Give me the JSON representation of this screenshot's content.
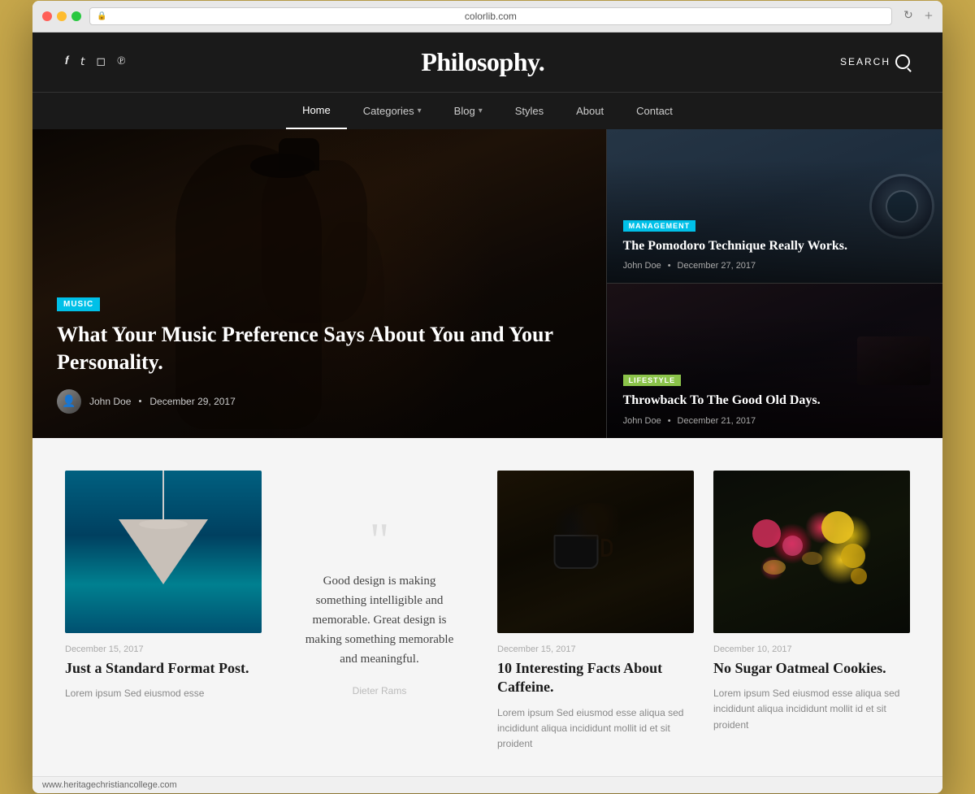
{
  "browser": {
    "url": "colorlib.com",
    "new_tab_label": "+"
  },
  "header": {
    "logo": "Philosophy.",
    "search_label": "SEARCH",
    "social_links": [
      {
        "icon": "facebook-icon",
        "symbol": "f"
      },
      {
        "icon": "twitter-icon",
        "symbol": "t"
      },
      {
        "icon": "instagram-icon",
        "symbol": "i"
      },
      {
        "icon": "pinterest-icon",
        "symbol": "p"
      }
    ]
  },
  "nav": {
    "items": [
      {
        "label": "Home",
        "active": true
      },
      {
        "label": "Categories",
        "has_dropdown": true
      },
      {
        "label": "Blog",
        "has_dropdown": true
      },
      {
        "label": "Styles"
      },
      {
        "label": "About"
      },
      {
        "label": "Contact"
      }
    ]
  },
  "hero": {
    "main_article": {
      "category": "MUSIC",
      "title": "What Your Music Preference Says About You and Your Personality.",
      "author": "John Doe",
      "date": "December 29, 2017"
    },
    "sidebar_articles": [
      {
        "category": "MANAGEMENT",
        "category_class": "badge-management",
        "title": "The Pomodoro Technique Really Works.",
        "author": "John Doe",
        "date": "December 27, 2017"
      },
      {
        "category": "LIFESTYLE",
        "category_class": "badge-lifestyle",
        "title": "Throwback To The Good Old Days.",
        "author": "John Doe",
        "date": "December 21, 2017"
      }
    ]
  },
  "content": {
    "posts": [
      {
        "type": "image",
        "date": "December 15, 2017",
        "title": "Just a Standard Format Post.",
        "excerpt": "Lorem ipsum Sed eiusmod esse"
      },
      {
        "type": "quote",
        "text": "Good design is making something intelligible and memorable. Great design is making something memorable and meaningful.",
        "author": "Dieter Rams"
      },
      {
        "type": "image",
        "date": "December 15, 2017",
        "title": "10 Interesting Facts About Caffeine.",
        "excerpt": "Lorem ipsum Sed eiusmod esse aliqua sed incididunt aliqua incididunt mollit id et sit proident"
      },
      {
        "type": "image",
        "date": "December 10, 2017",
        "title": "No Sugar Oatmeal Cookies.",
        "excerpt": "Lorem ipsum Sed eiusmod esse aliqua sed incididunt aliqua incididunt mollit id et sit proident"
      }
    ]
  },
  "statusbar": {
    "url": "www.heritagechristiancollege.com"
  }
}
